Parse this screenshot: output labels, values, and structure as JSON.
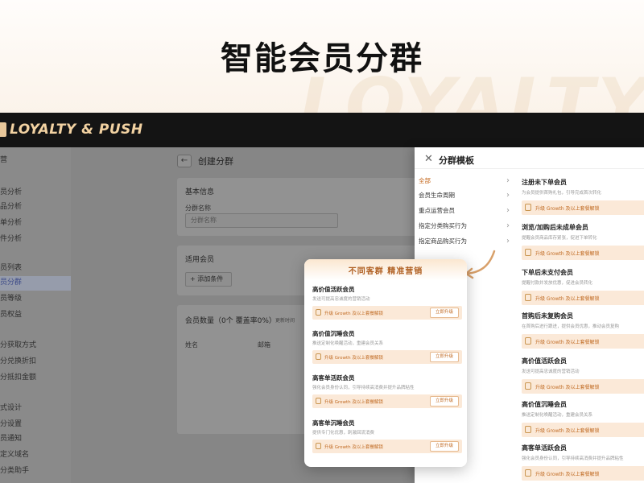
{
  "hero": {
    "title": "智能会员分群",
    "watermark": "LOYALTY"
  },
  "topbar": {
    "brand": "LOYALTY & PUSH"
  },
  "sidebar": {
    "items": [
      {
        "label": "营",
        "active": false
      },
      {
        "label": "",
        "active": false
      },
      {
        "label": "员分析",
        "active": false
      },
      {
        "label": "品分析",
        "active": false
      },
      {
        "label": "单分析",
        "active": false
      },
      {
        "label": "件分析",
        "active": false
      },
      {
        "label": "",
        "active": false
      },
      {
        "label": "员列表",
        "active": false
      },
      {
        "label": "员分群",
        "active": true
      },
      {
        "label": "员等级",
        "active": false
      },
      {
        "label": "员权益",
        "active": false
      },
      {
        "label": "",
        "active": false
      },
      {
        "label": "分获取方式",
        "active": false
      },
      {
        "label": "分兑换折扣",
        "active": false
      },
      {
        "label": "分抵扣金额",
        "active": false
      },
      {
        "label": "",
        "active": false
      },
      {
        "label": "式设计",
        "active": false
      },
      {
        "label": "分设置",
        "active": false
      },
      {
        "label": "员通知",
        "active": false
      },
      {
        "label": "定义域名",
        "active": false
      },
      {
        "label": "分类助手",
        "active": false
      }
    ]
  },
  "main": {
    "back_icon": "←",
    "title": "创建分群",
    "basic": {
      "heading": "基本信息",
      "field_label": "分群名称",
      "field_placeholder": "分群名称"
    },
    "applicable": {
      "heading": "适用会员",
      "add_label": "+ 添加条件"
    },
    "count": {
      "heading": "会员数量（0个 覆盖率0%）",
      "sub": "更新时间",
      "col_name": "姓名",
      "col_email": "邮箱"
    }
  },
  "panel": {
    "close_icon": "✕",
    "title": "分群模板",
    "categories": [
      {
        "label": "全部",
        "active": true
      },
      {
        "label": "会员生命周期",
        "active": false
      },
      {
        "label": "重点运营会员",
        "active": false
      },
      {
        "label": "指定分类购买行为",
        "active": false
      },
      {
        "label": "指定商品购买行为",
        "active": false
      }
    ],
    "chevron": "›",
    "templates": [
      {
        "name": "注册未下单会员",
        "desc": "为会员提供首购礼包，引导完成首次转化",
        "bar": "升级 Growth 及以上套餐解锁"
      },
      {
        "name": "浏览/加购后未成单会员",
        "desc": "提醒会员商品库存紧张，促进下单转化",
        "bar": "升级 Growth 及以上套餐解锁"
      },
      {
        "name": "下单后未支付会员",
        "desc": "提醒付款并发放优惠，促进会员转化",
        "bar": "升级 Growth 及以上套餐解锁"
      },
      {
        "name": "首购后未复购会员",
        "desc": "在首购后进行跟进，提供会员优惠，推动会员复购",
        "bar": "升级 Growth 及以上套餐解锁"
      },
      {
        "name": "高价值活跃会员",
        "desc": "发送可提高忠诚度的营销活动",
        "bar": "升级 Growth 及以上套餐解锁"
      },
      {
        "name": "高价值沉睡会员",
        "desc": "推送定制化唤醒活动，重建会员关系",
        "bar": "升级 Growth 及以上套餐解锁"
      },
      {
        "name": "高客单活跃会员",
        "desc": "强化会员身份认同，引导持续高消费并提升品牌粘性",
        "bar": "升级 Growth 及以上套餐解锁"
      }
    ]
  },
  "float": {
    "title": "不同客群 精准营销",
    "upgrade_label": "立即升级",
    "templates": [
      {
        "name": "高价值活跃会员",
        "desc": "发送可提高忠诚度的营销活动",
        "bar": "升级 Growth 及以上套餐解锁"
      },
      {
        "name": "高价值沉睡会员",
        "desc": "推送定制化唤醒活动，重建会员关系",
        "bar": "升级 Growth 及以上套餐解锁"
      },
      {
        "name": "高客单活跃会员",
        "desc": "强化会员身份认同，引导持续高消费并提升品牌粘性",
        "bar": "升级 Growth 及以上套餐解锁"
      },
      {
        "name": "高客单沉睡会员",
        "desc": "提供专门化优惠，刺激回流消费",
        "bar": "升级 Growth 及以上套餐解锁"
      }
    ]
  },
  "colors": {
    "accent": "#c4671b",
    "brand": "#f2d2a2",
    "bar_bg": "#fbe9d8"
  }
}
